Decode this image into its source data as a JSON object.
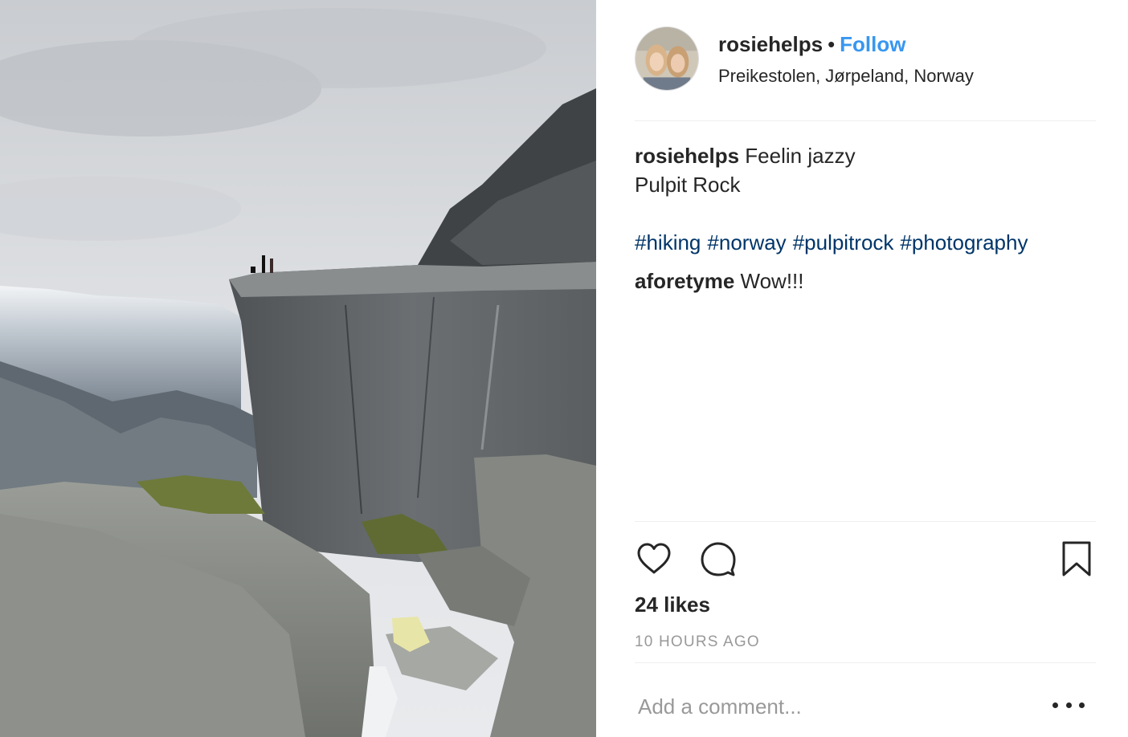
{
  "post": {
    "username": "rosiehelps",
    "separator": "•",
    "follow_label": "Follow",
    "location": "Preikestolen, Jørpeland, Norway"
  },
  "caption": {
    "username": "rosiehelps",
    "line1": "Feelin jazzy",
    "line2": "Pulpit Rock",
    "hashtags": [
      "#hiking",
      "#norway",
      "#pulpitrock",
      "#photography"
    ]
  },
  "comments": [
    {
      "username": "aforetyme",
      "text": "Wow!!!"
    }
  ],
  "actions": {
    "like_icon": "heart-icon",
    "comment_icon": "comment-bubble-icon",
    "save_icon": "bookmark-icon"
  },
  "likes": "24 likes",
  "timestamp": "10 HOURS AGO",
  "add_comment": {
    "placeholder": "Add a comment..."
  },
  "colors": {
    "follow": "#3897f0",
    "hashtag": "#003569",
    "muted": "#999999",
    "text": "#262626"
  }
}
